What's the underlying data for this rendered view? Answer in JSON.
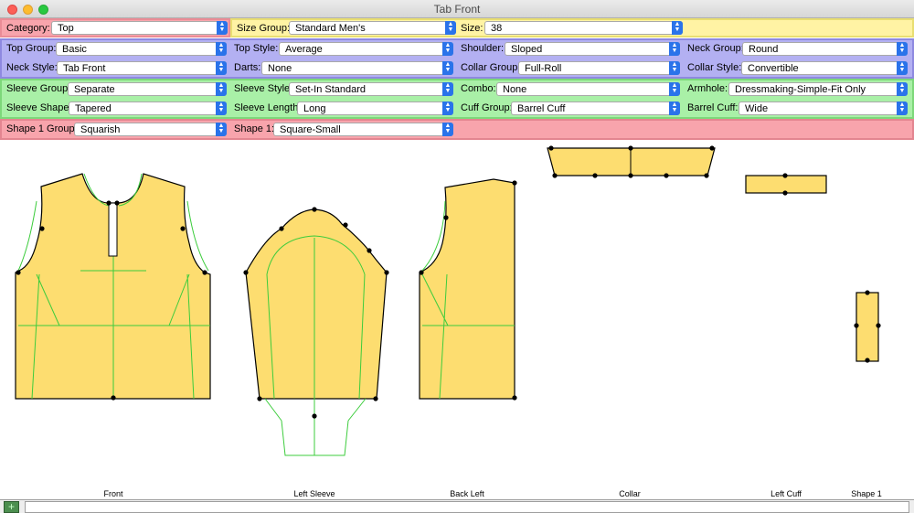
{
  "window": {
    "title": "Tab Front"
  },
  "rows": {
    "r1": [
      {
        "label": "Category:",
        "value": "Top"
      },
      {
        "label": "Size Group:",
        "value": "Standard Men's"
      },
      {
        "label": "Size:",
        "value": "38"
      }
    ],
    "r2": [
      {
        "label": "Top Group:",
        "value": "Basic"
      },
      {
        "label": "Top Style:",
        "value": "Average"
      },
      {
        "label": "Shoulder:",
        "value": "Sloped"
      },
      {
        "label": "Neck Group:",
        "value": "Round"
      }
    ],
    "r3": [
      {
        "label": "Neck Style:",
        "value": "Tab Front"
      },
      {
        "label": "Darts:",
        "value": "None"
      },
      {
        "label": "Collar Group:",
        "value": "Full-Roll"
      },
      {
        "label": "Collar Style:",
        "value": "Convertible"
      }
    ],
    "r4": [
      {
        "label": "Sleeve Group:",
        "value": "Separate"
      },
      {
        "label": "Sleeve Style:",
        "value": "Set-In Standard"
      },
      {
        "label": "Combo:",
        "value": "None"
      },
      {
        "label": "Armhole:",
        "value": "Dressmaking-Simple-Fit Only"
      }
    ],
    "r5": [
      {
        "label": "Sleeve Shape:",
        "value": "Tapered"
      },
      {
        "label": "Sleeve Length:",
        "value": "Long"
      },
      {
        "label": "Cuff Group:",
        "value": "Barrel Cuff"
      },
      {
        "label": "Barrel Cuff:",
        "value": "Wide"
      }
    ],
    "r6": [
      {
        "label": "Shape 1 Group:",
        "value": "Squarish"
      },
      {
        "label": "Shape 1:",
        "value": "Square-Small"
      }
    ]
  },
  "pieces": {
    "front": "Front",
    "left_sleeve": "Left Sleeve",
    "back_left": "Back Left",
    "collar": "Collar",
    "left_cuff": "Left Cuff",
    "shape1": "Shape 1"
  },
  "colors": {
    "piece_fill": "#fddd70",
    "seam_line": "#3ccc3c",
    "outline": "#000000"
  },
  "icons": {
    "add": "plus-icon"
  }
}
